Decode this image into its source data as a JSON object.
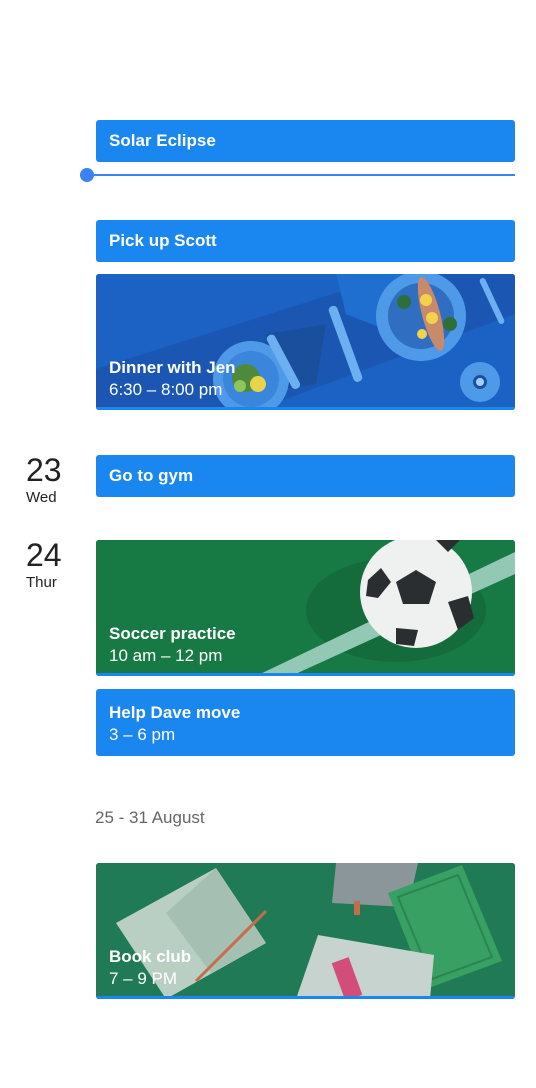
{
  "events": {
    "solar_eclipse": {
      "title": "Solar Eclipse"
    },
    "pickup_scott": {
      "title": "Pick up Scott"
    },
    "dinner": {
      "title": "Dinner with Jen",
      "time": "6:30 – 8:00 pm"
    },
    "gym": {
      "title": "Go to gym"
    },
    "soccer": {
      "title": "Soccer practice",
      "time": "10 am – 12 pm"
    },
    "dave": {
      "title": "Help Dave move",
      "time": "3 – 6 pm"
    },
    "book_club": {
      "title": "Book club",
      "time": "7 – 9 PM"
    }
  },
  "days": {
    "d23": {
      "num": "23",
      "label": "Wed"
    },
    "d24": {
      "num": "24",
      "label": "Thur"
    }
  },
  "week_header": "25 - 31 August",
  "colors": {
    "event_blue": "#1a86ef",
    "now_indicator": "#3b82f6",
    "soccer_green": "#177a44",
    "book_green": "#1f7a55"
  },
  "icons": {
    "dinner_art": "plates-cutlery-illustration",
    "soccer_art": "soccer-ball-illustration",
    "book_art": "books-illustration"
  }
}
